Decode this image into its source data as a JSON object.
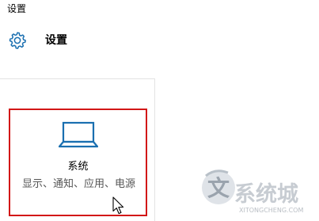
{
  "window": {
    "title": "设置"
  },
  "header": {
    "icon": "gear-icon",
    "title": "设置"
  },
  "tile": {
    "icon": "laptop-icon",
    "title": "系统",
    "description": "显示、通知、应用、电源"
  },
  "colors": {
    "accent": "#1a6fb0",
    "highlight_border": "#d21717",
    "description_text": "#555555"
  },
  "watermark": {
    "glyph": "文",
    "text": "系统城",
    "subtext": "XITONGCHENG.COM"
  }
}
